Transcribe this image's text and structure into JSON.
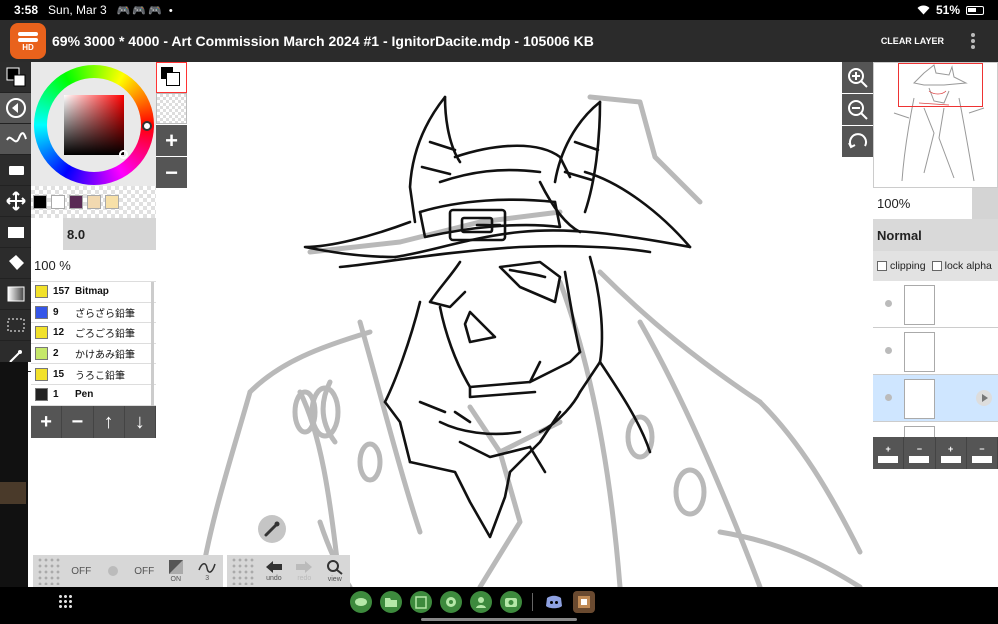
{
  "status": {
    "time": "3:58",
    "date": "Sun, Mar 3",
    "notif_icons": "🎮🎮🎮 •",
    "battery": "51%"
  },
  "title": {
    "text": "69% 3000 * 4000 - Art Commission March 2024 #1 - IgnitorDacite.mdp - 105006 KB",
    "clear_layer": "CLEAR LAYER",
    "app_badge": "HD"
  },
  "brush": {
    "size": "8.0",
    "opacity": "100 %",
    "list": [
      {
        "num": "157",
        "name": "Bitmap",
        "color": "#f2e12a",
        "bold": true
      },
      {
        "num": "9",
        "name": "ざらざら鉛筆",
        "color": "#3556e8",
        "bold": false
      },
      {
        "num": "12",
        "name": "ごろごろ鉛筆",
        "color": "#f2e12a",
        "bold": false
      },
      {
        "num": "2",
        "name": "かけあみ鉛筆",
        "color": "#c6e86a",
        "bold": false
      },
      {
        "num": "15",
        "name": "うろこ鉛筆",
        "color": "#f2e12a",
        "bold": false
      },
      {
        "num": "1",
        "name": "Pen",
        "color": "#222222",
        "bold": true
      }
    ],
    "buttons": [
      "+",
      "−",
      "↑",
      "↓"
    ]
  },
  "swatches": [
    "#000000",
    "#ffffff",
    "#5a2a55",
    "#f2d9b0",
    "#f7e0a8"
  ],
  "layers": {
    "opacity": "100%",
    "blend_mode": "Normal",
    "clipping_label": "clipping",
    "lock_alpha_label": "lock alpha",
    "buttons": [
      "+",
      "−",
      "+",
      "−"
    ]
  },
  "quickbar": {
    "off1": "OFF",
    "off2": "OFF",
    "on": "ON",
    "stab": "3",
    "undo": "undo",
    "redo": "redo",
    "view": "view"
  },
  "fgcol": {
    "plus": "+",
    "minus": "−"
  }
}
